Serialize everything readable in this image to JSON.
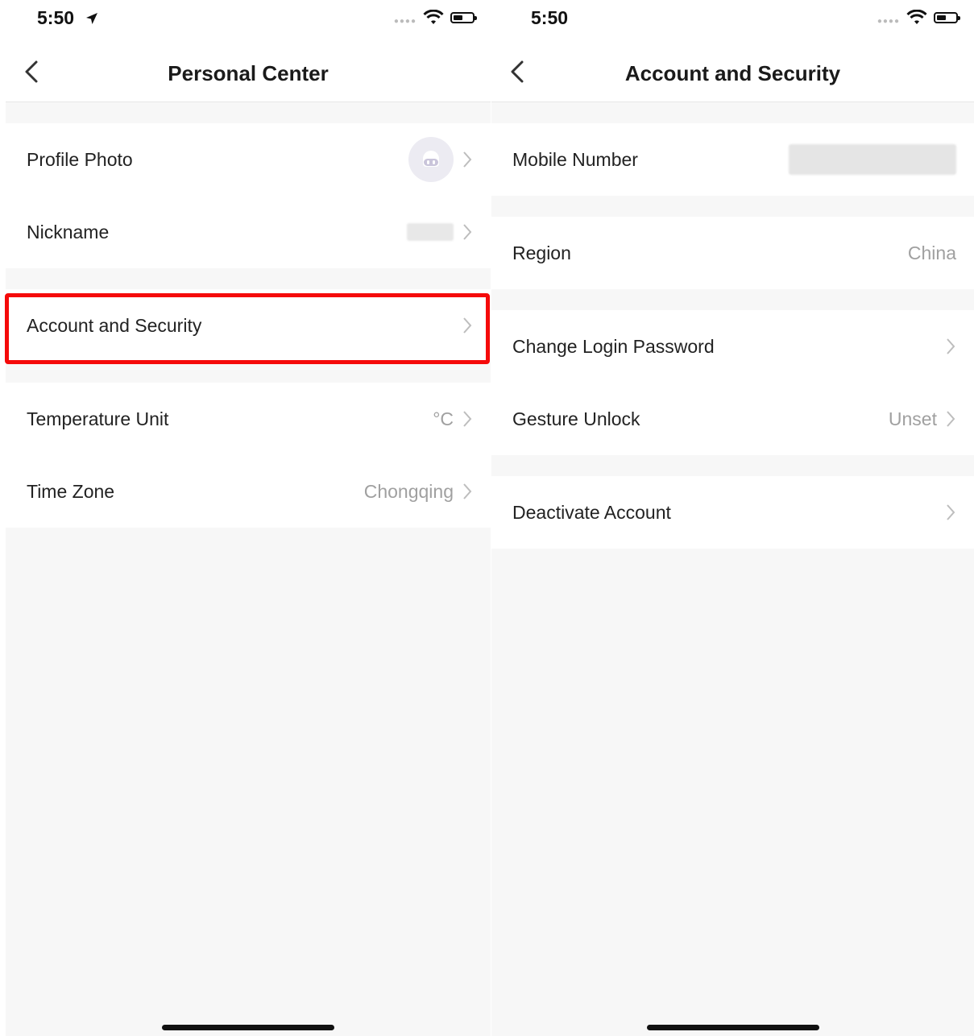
{
  "left": {
    "status_time": "5:50",
    "status_location_icon": "location-arrow-icon",
    "title": "Personal Center",
    "rows": [
      {
        "label": "Profile Photo"
      },
      {
        "label": "Nickname"
      },
      {
        "label": "Account and Security"
      },
      {
        "label": "Temperature Unit",
        "value": "°C"
      },
      {
        "label": "Time Zone",
        "value": "Chongqing"
      }
    ]
  },
  "right": {
    "status_time": "5:50",
    "title": "Account and Security",
    "rows": [
      {
        "label": "Mobile Number"
      },
      {
        "label": "Region",
        "value": "China"
      },
      {
        "label": "Change Login Password"
      },
      {
        "label": "Gesture Unlock",
        "value": "Unset"
      },
      {
        "label": "Deactivate Account"
      }
    ]
  },
  "colors": {
    "highlight": "#f50a0a",
    "background": "#f7f7f7",
    "value_text": "#a0a0a0"
  }
}
